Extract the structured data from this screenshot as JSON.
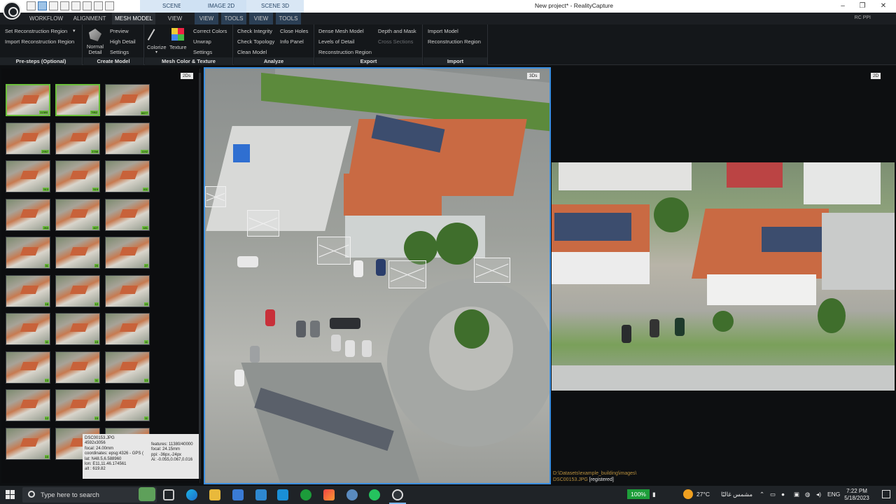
{
  "titlebar": {
    "window_title": "New project* - RealityCapture",
    "tabs": [
      "SCENE 2D",
      "IMAGE 2D",
      "SCENE 3D"
    ],
    "minimize": "–",
    "maximize": "❐",
    "close": "✕"
  },
  "ribbon_tabs": {
    "workflow": "WORKFLOW",
    "alignment": "ALIGNMENT",
    "mesh_model": "MESH MODEL",
    "view1": "VIEW",
    "view2": "VIEW",
    "tools1": "TOOLS",
    "view3": "VIEW",
    "tools2": "TOOLS",
    "rcppi": "RC PPI"
  },
  "ribbon": {
    "presteps": {
      "label": "Pre-steps (Optional)",
      "items": [
        "Set Reconstruction Region",
        "Import Reconstruction Region"
      ]
    },
    "create_model": {
      "label": "Create Model",
      "normal_detail": "Normal Detail",
      "items": [
        "Preview",
        "High Detail",
        "Settings"
      ]
    },
    "mesh_color": {
      "label": "Mesh Color & Texture",
      "colorize": "Colorize",
      "texture": "Texture",
      "items": [
        "Correct Colors",
        "Unwrap",
        "Settings"
      ]
    },
    "analyze": {
      "label": "Analyze",
      "col1": [
        "Check Integrity",
        "Check Topology",
        "Clean Model"
      ],
      "col2": [
        "Close Holes",
        "Info Panel"
      ]
    },
    "export": {
      "label": "Export",
      "col1": [
        "Dense Mesh Model",
        "Levels of Detail",
        "Reconstruction Region"
      ],
      "col2": [
        "Depth and Mask",
        "Cross Sections"
      ]
    },
    "import": {
      "label": "Import",
      "items": [
        "Import Model",
        "Reconstruction Region"
      ]
    }
  },
  "panels": {
    "left_badge": "2Ds",
    "view3d_badge": "3Ds",
    "view2d_badge": "2D"
  },
  "thumb_badges": [
    "11380",
    "7952",
    "6677",
    "2957",
    "3788",
    "1192",
    "513",
    "519",
    "411",
    "263",
    "427",
    "181",
    "31",
    "20",
    "27",
    "18",
    "12",
    "15",
    "11",
    "15",
    "11",
    "13",
    "11",
    "13",
    "12",
    "15",
    "11",
    "10",
    "12",
    "11"
  ],
  "tooltip": {
    "name": "DSC00153.JPG",
    "size": "4592x3056",
    "focal": "focal: 24.00mm",
    "coords": "coordinates: epsg:4326 - GPS (",
    "lat": "lat: N48.5,6.588960",
    "lon": "lon: E11,11.46.174561",
    "alt": "alt : 619.82",
    "features": "features: 11380/40000",
    "focal2": "focal: 24.15mm",
    "ppi": "ppi: -36px,-24px",
    "ai": "Ai: -0.055,0.067,0.016"
  },
  "path": {
    "line1": "D:\\Datasets\\example_building\\images\\",
    "file": "DSC00153.JPG",
    "status": "[registered]"
  },
  "taskbar": {
    "search_placeholder": "Type here to search",
    "battery": "100%",
    "weather": "27°C",
    "weather_desc": "مشمس غالبًا",
    "lang": "ENG",
    "time": "7:22 PM",
    "date": "5/18/2023"
  },
  "colors": {
    "accent": "#3a8ee0",
    "selected_thumb": "#6bbf3b",
    "path_text": "#b9903e"
  }
}
